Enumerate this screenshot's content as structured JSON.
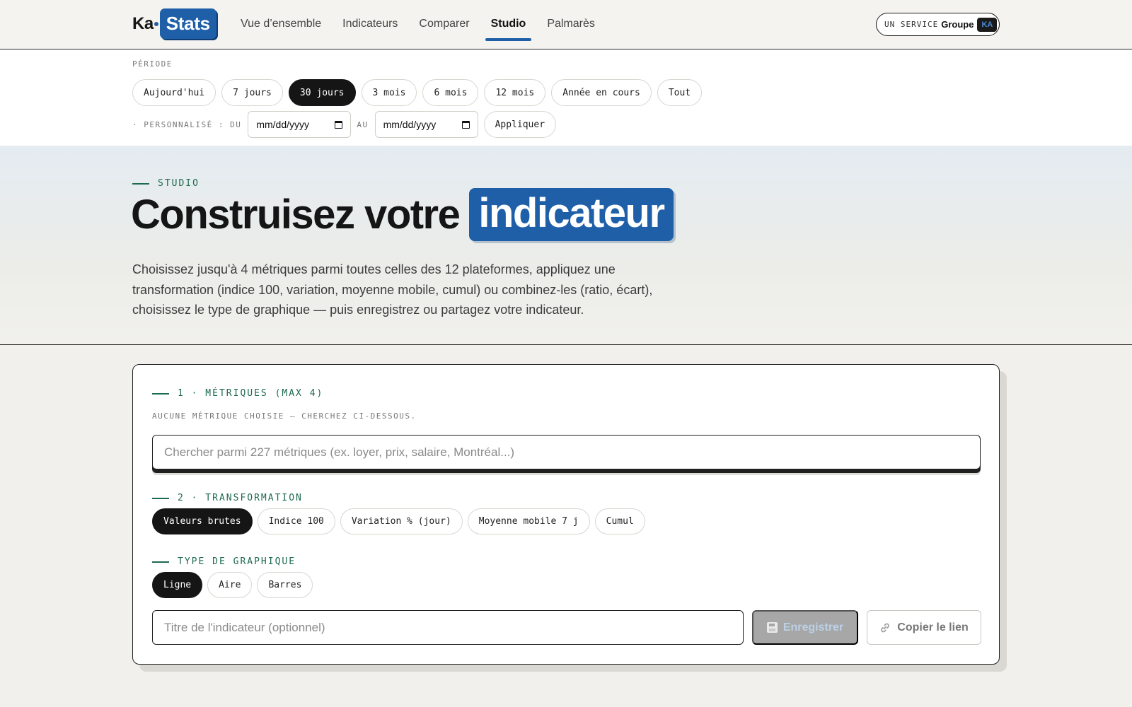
{
  "brand": {
    "prefix": "Ka",
    "name": "Stats"
  },
  "nav": {
    "items": [
      {
        "label": "Vue d’ensemble",
        "active": false
      },
      {
        "label": "Indicateurs",
        "active": false
      },
      {
        "label": "Comparer",
        "active": false
      },
      {
        "label": "Studio",
        "active": true
      },
      {
        "label": "Palmarès",
        "active": false
      }
    ]
  },
  "service": {
    "label": "UN SERVICE",
    "brand": "Groupe",
    "badge": "KA"
  },
  "period": {
    "label": "PÉRIODE",
    "options": [
      "Aujourd'hui",
      "7 jours",
      "30 jours",
      "3 mois",
      "6 mois",
      "12 mois",
      "Année en cours",
      "Tout"
    ],
    "selected": "30 jours",
    "custom_label": "· PERSONNALISÉ : DU",
    "to_label": "AU",
    "from_placeholder": "mm/dd/yyyy",
    "to_placeholder": "mm/dd/yyyy",
    "apply_label": "Appliquer"
  },
  "hero": {
    "eyebrow": "STUDIO",
    "title": "Construisez votre",
    "title_highlight": "indicateur",
    "description": "Choisissez jusqu'à 4 métriques parmi toutes celles des 12 plateformes, appliquez une transformation (indice 100, variation, moyenne mobile, cumul) ou combinez-les (ratio, écart), choisissez le type de graphique — puis enregistrez ou partagez votre indicateur."
  },
  "builder": {
    "metrics": {
      "heading": "1 · MÉTRIQUES (MAX 4)",
      "hint": "AUCUNE MÉTRIQUE CHOISIE — CHERCHEZ CI-DESSOUS.",
      "search_placeholder": "Chercher parmi 227 métriques (ex. loyer, prix, salaire, Montréal...)",
      "search_value": ""
    },
    "transformation": {
      "heading": "2 · TRANSFORMATION",
      "options": [
        "Valeurs brutes",
        "Indice 100",
        "Variation % (jour)",
        "Moyenne mobile 7 j",
        "Cumul"
      ],
      "selected": "Valeurs brutes"
    },
    "chart_type": {
      "heading": "TYPE DE GRAPHIQUE",
      "options": [
        "Ligne",
        "Aire",
        "Barres"
      ],
      "selected": "Ligne"
    },
    "title_placeholder": "Titre de l'indicateur (optionnel)",
    "title_value": "",
    "save_label": "Enregistrer",
    "save_disabled": true,
    "copy_label": "Copier le lien"
  },
  "colors": {
    "accent_blue": "#1f5fa8",
    "accent_green": "#1e6a4d",
    "active_chip": "#151515",
    "background": "#f1f0ec"
  }
}
